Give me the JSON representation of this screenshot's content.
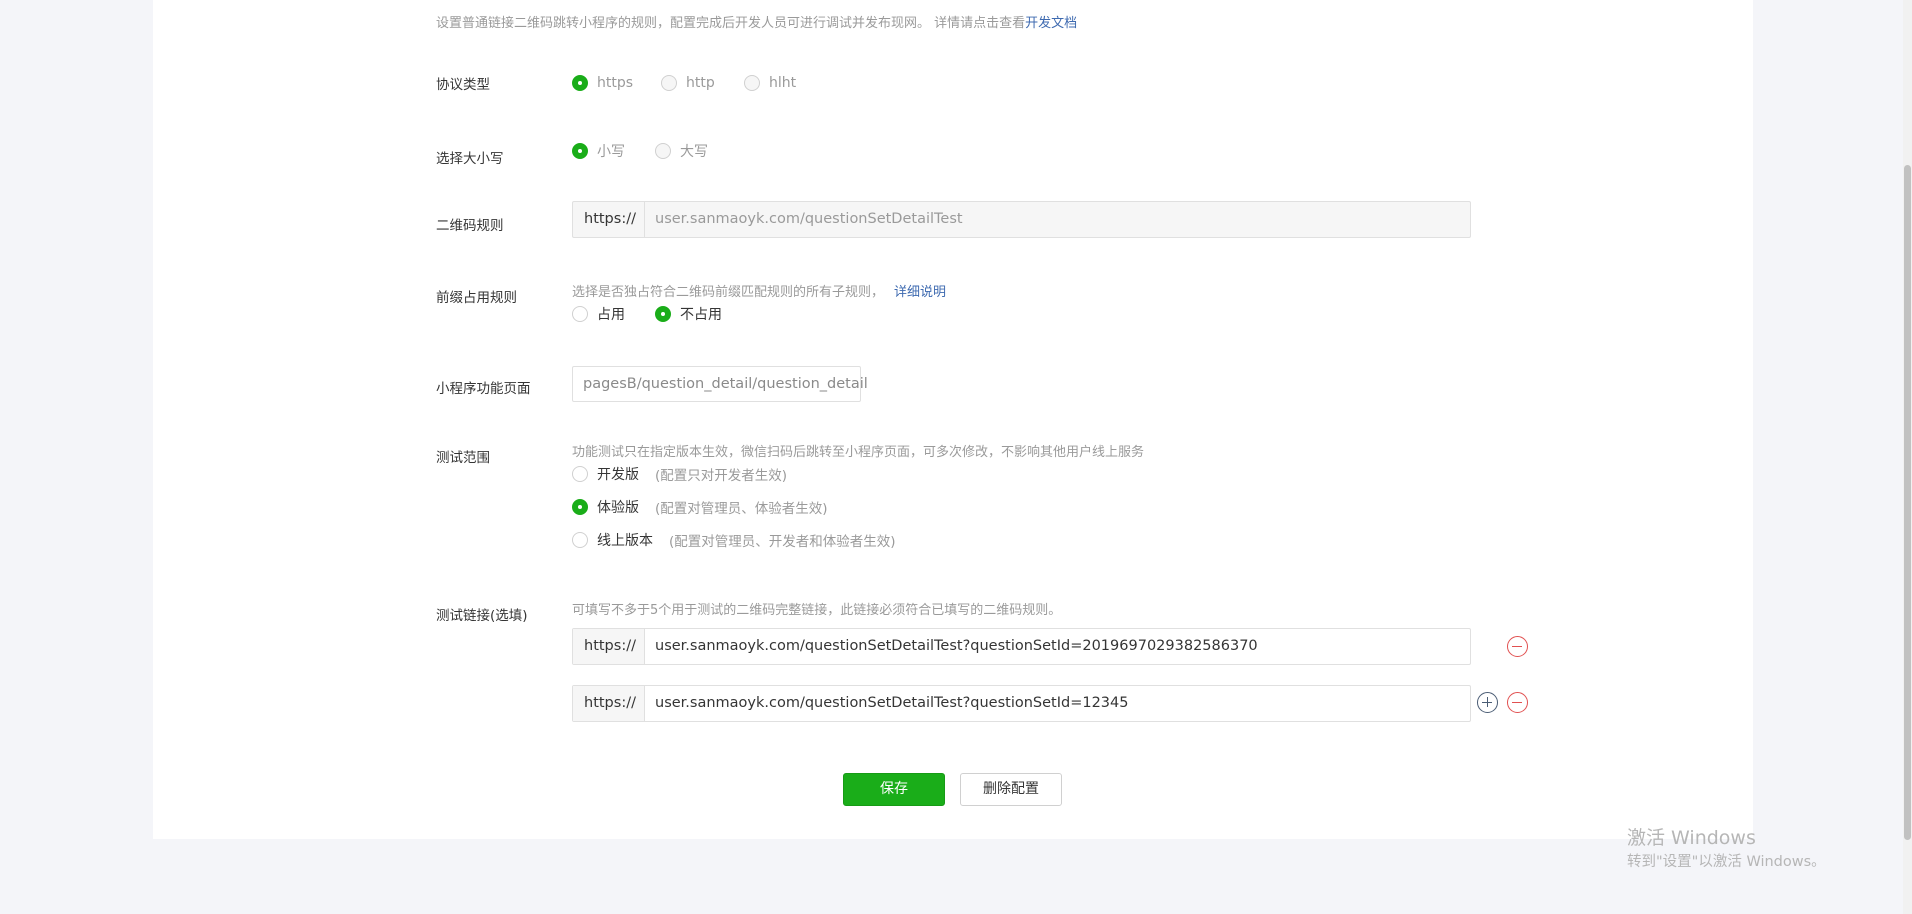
{
  "intro": {
    "text": "设置普通链接二维码跳转小程序的规则，配置完成后开发人员可进行调试并发布现网。 详情请点击查看",
    "link": "开发文档"
  },
  "protocol": {
    "label": "协议类型",
    "options": [
      "https",
      "http",
      "hlht"
    ],
    "selected": "https"
  },
  "letter_case": {
    "label": "选择大小写",
    "options": [
      "小写",
      "大写"
    ],
    "selected": "小写"
  },
  "qr_rule": {
    "label": "二维码规则",
    "prefix": "https://",
    "value": "user.sanmaoyk.com/questionSetDetailTest"
  },
  "prefix_rule": {
    "label": "前缀占用规则",
    "desc": "选择是否独占符合二维码前缀匹配规则的所有子规则，",
    "link": "详细说明",
    "options": [
      "占用",
      "不占用"
    ],
    "selected": "不占用"
  },
  "mini_page": {
    "label": "小程序功能页面",
    "value": "pagesB/question_detail/question_detail"
  },
  "test_scope": {
    "label": "测试范围",
    "desc": "功能测试只在指定版本生效，微信扫码后跳转至小程序页面，可多次修改，不影响其他用户线上服务",
    "options": [
      {
        "name": "开发版",
        "hint": "(配置只对开发者生效)"
      },
      {
        "name": "体验版",
        "hint": "(配置对管理员、体验者生效)"
      },
      {
        "name": "线上版本",
        "hint": "(配置对管理员、开发者和体验者生效)"
      }
    ],
    "selected": "体验版"
  },
  "test_links": {
    "label": "测试链接(选填)",
    "desc": "可填写不多于5个用于测试的二维码完整链接，此链接必须符合已填写的二维码规则。",
    "items": [
      {
        "prefix": "https://",
        "value": "user.sanmaoyk.com/questionSetDetailTest?questionSetId=2019697029382586370"
      },
      {
        "prefix": "https://",
        "value": "user.sanmaoyk.com/questionSetDetailTest?questionSetId=12345"
      }
    ]
  },
  "actions": {
    "save": "保存",
    "delete": "删除配置"
  },
  "watermark": {
    "title": "激活 Windows",
    "sub": "转到\"设置\"以激活 Windows。"
  },
  "colors": {
    "accent": "#1aad19",
    "link": "#3e6ab0",
    "danger": "#e15050"
  }
}
